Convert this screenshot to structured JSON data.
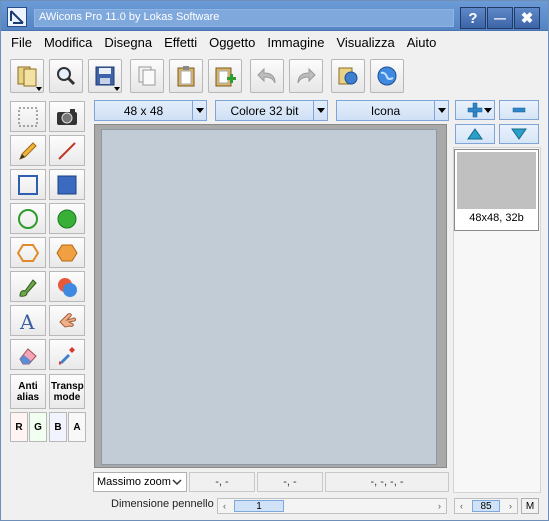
{
  "window": {
    "title": "AWicons Pro 11.0 by Lokas Software",
    "buttons": {
      "help": "?",
      "minimize": "—",
      "close": "✖"
    }
  },
  "menu": [
    "File",
    "Modifica",
    "Disegna",
    "Effetti",
    "Oggetto",
    "Immagine",
    "Visualizza",
    "Aiuto"
  ],
  "toolbar": [
    "open-icon",
    "zoom-icon",
    "save-icon",
    "copy-icon",
    "clipboard-icon",
    "paste-new-icon",
    "undo-icon",
    "redo-icon",
    "library-icon",
    "web-icon"
  ],
  "format_bar": {
    "size": "48 x 48",
    "colors": "Colore 32 bit",
    "type": "Icona"
  },
  "tools": {
    "anti_alias": "Anti alias",
    "transp_mode": "Transp mode",
    "channels": [
      "R",
      "G",
      "B",
      "A"
    ]
  },
  "status": {
    "zoom": "Massimo zoom",
    "cell1": "-, -",
    "cell2": "-, -",
    "cell3": "-, -, -, -",
    "pen_label": "Dimensione pennello",
    "pen_value": "1",
    "preview_zoom": "85",
    "m_button": "M"
  },
  "preview": {
    "label": "48x48, 32b"
  },
  "colors": {
    "title_bar": "#5b89c9",
    "canvas": "#c1ccd6",
    "accent": "#7fa4d8"
  }
}
